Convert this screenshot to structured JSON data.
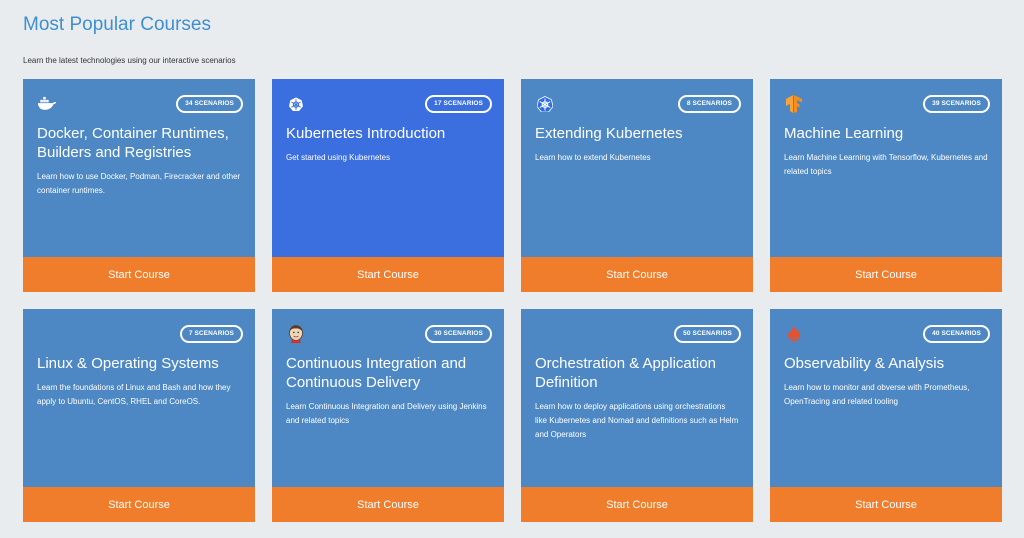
{
  "header": {
    "title": "Most Popular Courses",
    "subtitle": "Learn the latest technologies using our interactive scenarios"
  },
  "courses": [
    {
      "icon": "docker-whale-icon",
      "badge": "34 SCENARIOS",
      "title": "Docker, Container Runtimes, Builders and Registries",
      "description": "Learn how to use Docker, Podman, Firecracker and other container runtimes.",
      "button": "Start Course"
    },
    {
      "icon": "kubernetes-helm-icon",
      "badge": "17 SCENARIOS",
      "title": "Kubernetes Introduction",
      "description": "Get started using Kubernetes",
      "button": "Start Course"
    },
    {
      "icon": "kubernetes-helm-icon",
      "badge": "8 SCENARIOS",
      "title": "Extending Kubernetes",
      "description": "Learn how to extend Kubernetes",
      "button": "Start Course"
    },
    {
      "icon": "tensorflow-icon",
      "badge": "39 SCENARIOS",
      "title": "Machine Learning",
      "description": "Learn Machine Learning with Tensorflow, Kubernetes and related topics",
      "button": "Start Course"
    },
    {
      "icon": "",
      "badge": "7 SCENARIOS",
      "title": "Linux & Operating Systems",
      "description": "Learn the foundations of Linux and Bash and how they apply to Ubuntu, CentOS, RHEL and CoreOS.",
      "button": "Start Course"
    },
    {
      "icon": "jenkins-icon",
      "badge": "30 SCENARIOS",
      "title": "Continuous Integration and Continuous Delivery",
      "description": "Learn Continuous Integration and Delivery using Jenkins and related topics",
      "button": "Start Course"
    },
    {
      "icon": "",
      "badge": "50 SCENARIOS",
      "title": "Orchestration & Application Definition",
      "description": "Learn how to deploy applications using orchestrations like Kubernetes and Nomad and definitions such as Helm and Operators",
      "button": "Start Course"
    },
    {
      "icon": "prometheus-icon",
      "badge": "40 SCENARIOS",
      "title": "Observability & Analysis",
      "description": "Learn how to monitor and obverse with Prometheus, OpenTracing and related tooling",
      "button": "Start Course"
    }
  ],
  "colors": {
    "card": "#4d88c4",
    "card_active": "#3b6fdf",
    "button": "#ef7d2b",
    "title": "#3f8fd0",
    "background": "#e9ecef"
  }
}
